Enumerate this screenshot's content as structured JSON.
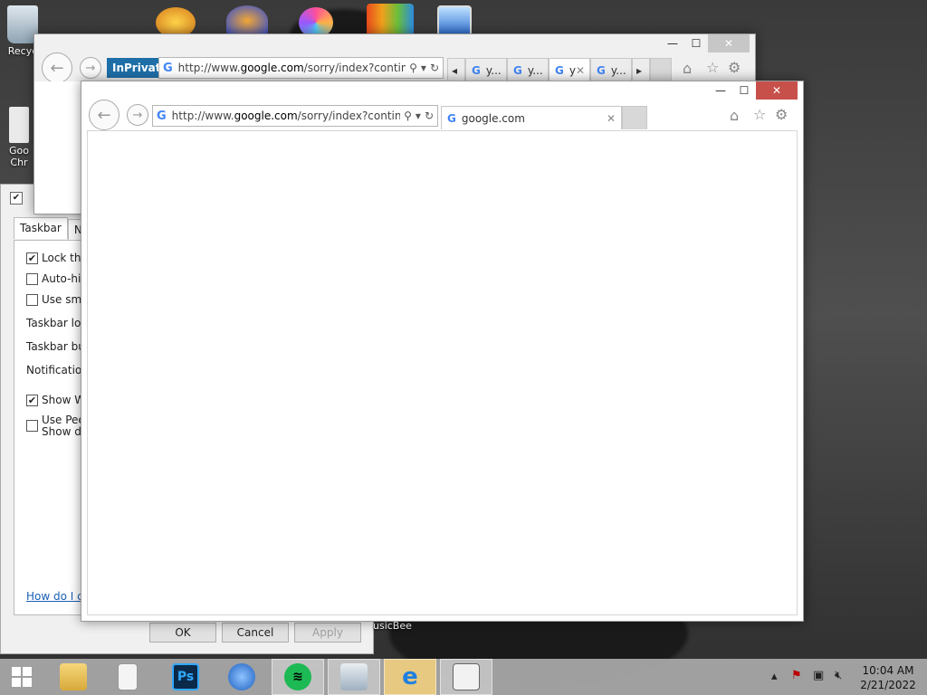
{
  "desktop": {
    "icons": [
      {
        "label": "Recyc"
      },
      {
        "label": "Goo"
      },
      {
        "label": "Chr"
      }
    ],
    "musicbee_label": "usicBee"
  },
  "ie_back": {
    "inprivate": "InPrivate",
    "url_prefix": "http://www.",
    "url_domain": "google.com",
    "url_rest": "/sorry/index?contin",
    "tabs": [
      {
        "label": "y..."
      },
      {
        "label": "y..."
      },
      {
        "label": "y"
      },
      {
        "label": "y..."
      }
    ]
  },
  "ie_front": {
    "url_prefix": "http://www.",
    "url_domain": "google.com",
    "url_rest": "/sorry/index?contin",
    "tab_label": "google.com"
  },
  "dialog": {
    "tabs": [
      "Taskbar",
      "Nav"
    ],
    "options": [
      {
        "label": "Lock the",
        "checked": "✔"
      },
      {
        "label": "Auto-hide",
        "checked": ""
      },
      {
        "label": "Use small",
        "checked": ""
      }
    ],
    "fields": [
      "Taskbar loca",
      "Taskbar butt",
      "Notification a"
    ],
    "show_win": {
      "label": "Show Win",
      "checked": "✔"
    },
    "peek": {
      "line1": "Use Peek",
      "line2": "Show des",
      "checked": ""
    },
    "help_link": "How do I cus",
    "ok": "OK",
    "cancel": "Cancel",
    "apply": "Apply"
  },
  "taskbar": {
    "clock_time": "10:04 AM",
    "clock_date": "2/21/2022",
    "photoshop_label": "Ps"
  },
  "colors": {
    "close_active": "#c7504b",
    "inprivate": "#1e6fa8",
    "link": "#1a5fb4"
  }
}
